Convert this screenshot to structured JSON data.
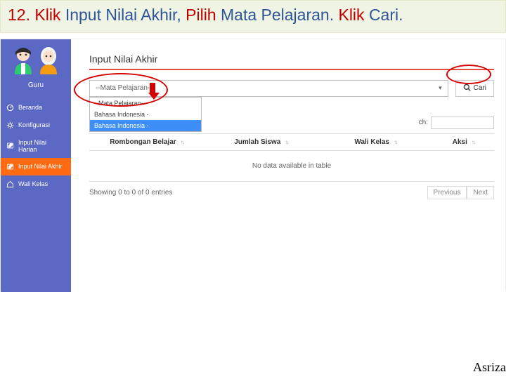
{
  "slide_title": {
    "t1": "12. Klik ",
    "t2": "Input Nilai Akhir, ",
    "t3": "Pilih ",
    "t4": "Mata Pelajaran. ",
    "t5": "Klik ",
    "t6": "Cari."
  },
  "sidebar": {
    "guru": "Guru",
    "items": [
      {
        "label": "Beranda",
        "name": "sidebar-item-beranda",
        "icon": "dashboard-icon"
      },
      {
        "label": "Konfigurasi",
        "name": "sidebar-item-konfigurasi",
        "icon": "gear-icon"
      },
      {
        "label": "Input Nilai Harian",
        "name": "sidebar-item-input-nilai-harian",
        "icon": "pencil-icon"
      },
      {
        "label": "Input Nilai Akhir",
        "name": "sidebar-item-input-nilai-akhir",
        "icon": "pencil-icon"
      },
      {
        "label": "Wali Kelas",
        "name": "sidebar-item-wali-kelas",
        "icon": "home-icon"
      }
    ]
  },
  "main": {
    "title": "Input Nilai Akhir",
    "select_placeholder": "--Mata Pelajaran--",
    "dropdown": [
      "--Mata Pelajaran--",
      "Bahasa Indonesia -",
      "Bahasa Indonesia -"
    ],
    "cari": "Cari",
    "search_abbrev": "ch:",
    "columns": [
      "Rombongan Belajar",
      "Jumlah Siswa",
      "Wali Kelas",
      "Aksi"
    ],
    "no_data": "No data available in table",
    "foot_info": "Showing 0 to 0 of 0 entries",
    "prev": "Previous",
    "next": "Next"
  },
  "footer": {
    "author": "Asriza"
  }
}
